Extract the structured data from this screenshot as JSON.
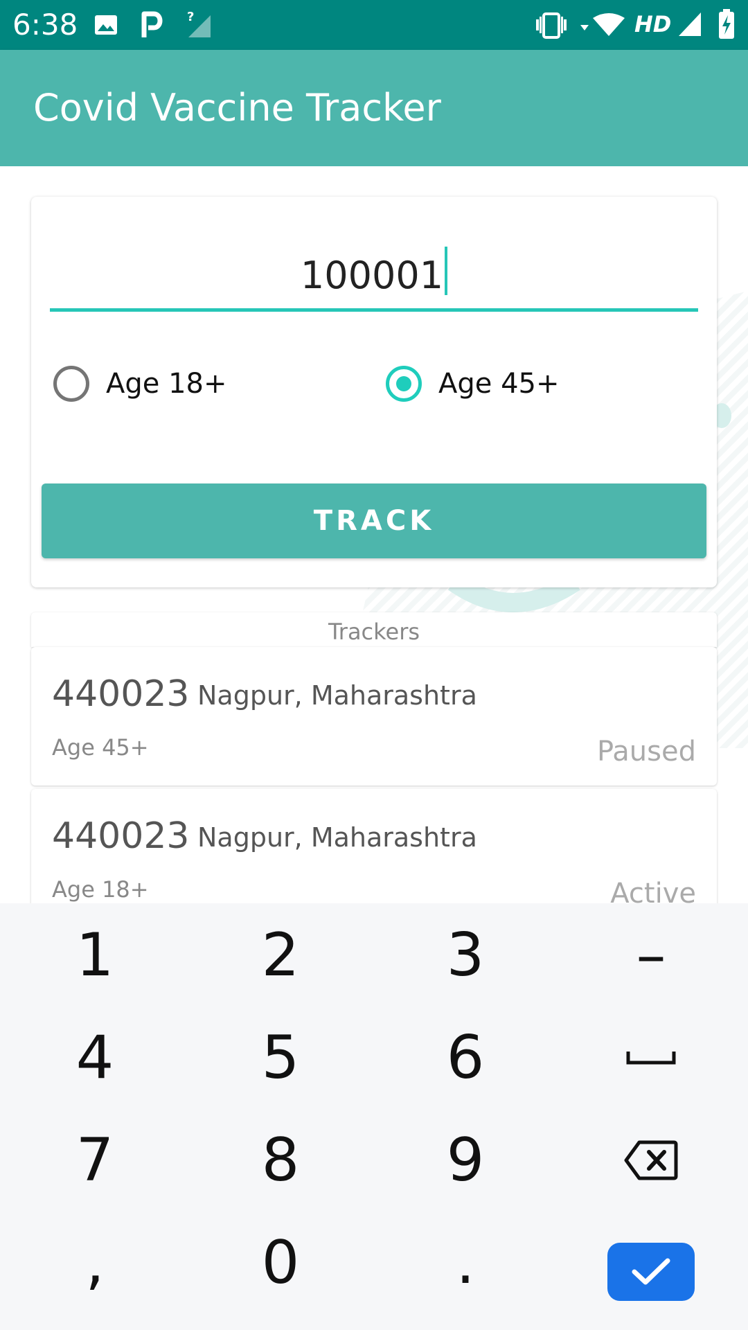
{
  "status_bar": {
    "time": "6:38",
    "network_type": "HD",
    "icons": [
      "image-icon",
      "parking-icon",
      "no-signal-icon",
      "vibrate-icon",
      "wifi-icon",
      "signal-icon",
      "battery-charging-icon"
    ]
  },
  "app_bar": {
    "title": "Covid Vaccine Tracker"
  },
  "form": {
    "pin_value": "100001",
    "radio_options": [
      {
        "label": "Age 18+",
        "selected": false
      },
      {
        "label": "Age 45+",
        "selected": true
      }
    ],
    "track_label": "TRACK"
  },
  "trackers": {
    "header": "Trackers",
    "items": [
      {
        "pin": "440023",
        "location": "Nagpur, Maharashtra",
        "age": "Age 45+",
        "status": "Paused"
      },
      {
        "pin": "440023",
        "location": "Nagpur, Maharashtra",
        "age": "Age 18+",
        "status": "Active"
      }
    ]
  },
  "keyboard": {
    "keys": [
      "1",
      "2",
      "3",
      "–",
      "4",
      "5",
      "6",
      "7",
      "8",
      "9",
      ",",
      "0",
      "."
    ],
    "icons": [
      "space-icon",
      "backspace-icon",
      "done-check-icon"
    ]
  },
  "colors": {
    "status_bar": "#00867f",
    "app_bar": "#4db6ac",
    "accent": "#26c6b7",
    "done_key": "#1a73e8"
  }
}
